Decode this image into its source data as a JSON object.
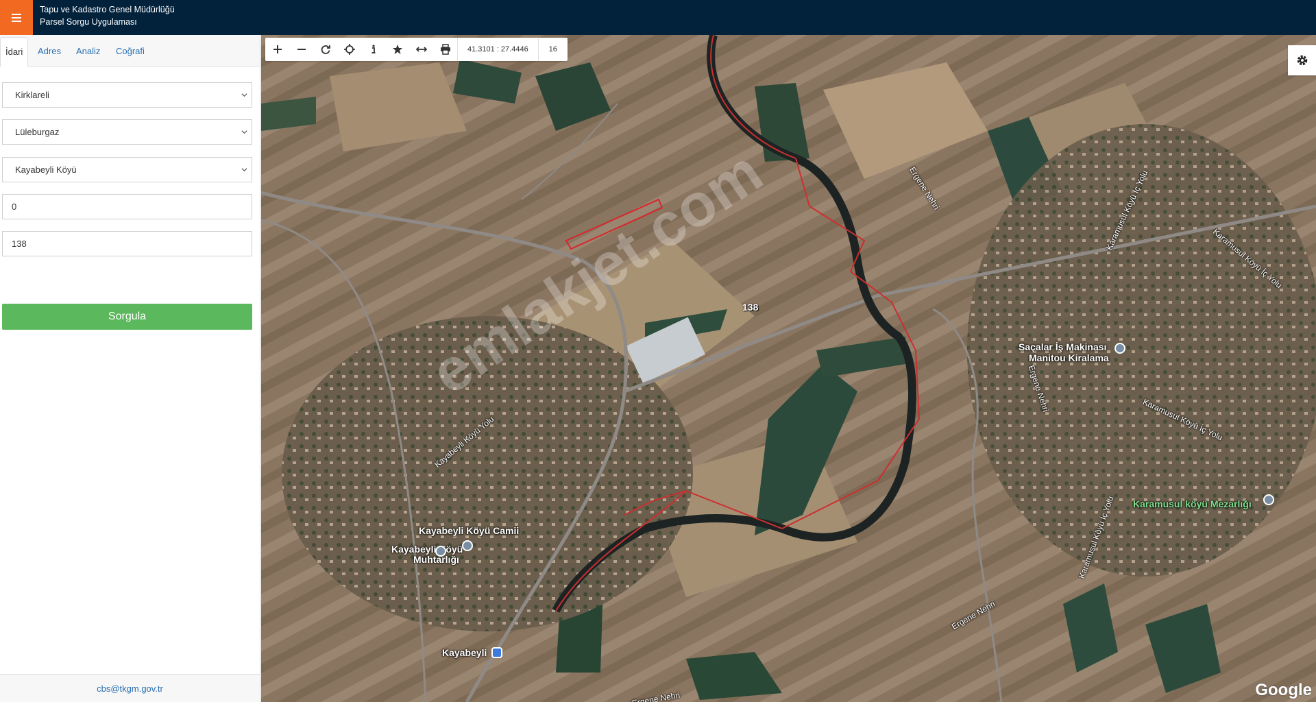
{
  "header": {
    "org": "Tapu ve Kadastro Genel Müdürlüğü",
    "app": "Parsel Sorgu Uygulaması",
    "menu_icon": "hamburger-icon",
    "accent": "#f26a22",
    "bg": "#02223c"
  },
  "sidebar": {
    "tabs": [
      {
        "label": "İdari",
        "active": true
      },
      {
        "label": "Adres",
        "active": false
      },
      {
        "label": "Analiz",
        "active": false
      },
      {
        "label": "Coğrafi",
        "active": false
      }
    ],
    "il": "Kirklareli",
    "ilce": "Lüleburgaz",
    "mahalle": "Kayabeyli Köyü",
    "ada": "0",
    "parsel": "138",
    "query_button": "Sorgula",
    "query_button_color": "#5cb85c",
    "footer_email": "cbs@tkgm.gov.tr"
  },
  "map": {
    "coords": "41.3101 : 27.4446",
    "zoom": "16",
    "parcel_label": "138",
    "watermark": "emlakjet.com",
    "labels": {
      "saclar": "Saçalar İş Makinası",
      "manitou": "Manitou Kiralama",
      "camii": "Kayabeyli Köyü Camii",
      "muhtarlik1": "Kayabeyli Köyü",
      "muhtarlik2": "Muhtarlığı",
      "kayabeyli": "Kayabeyli",
      "mezarlik": "Karamusul köyü Mezarlığı",
      "ergene1": "Ergene Nehri",
      "ergene2": "Ergene Nehri",
      "ergene3": "Ergene Nehri",
      "ergene4": "Ergene Nehri",
      "kayabeyli_yolu": "Kayabeyli Köyü Yolu",
      "karamusul1": "Karamusul Köyü İç Yolu",
      "karamusul2": "Karamusul Köyü İç Yolu",
      "karamusul3": "Karamusul Köyü İç Yolu",
      "karamusul4": "Karamusul Köyü İç Yolu"
    },
    "attribution": "Google"
  }
}
